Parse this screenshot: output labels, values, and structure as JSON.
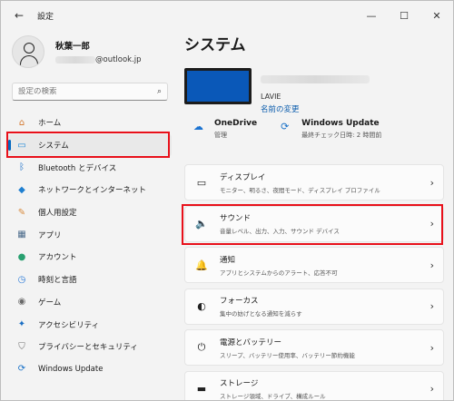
{
  "window": {
    "title": "設定",
    "back": "←",
    "minimize": "—",
    "maximize": "☐",
    "close": "✕"
  },
  "profile": {
    "name": "秋葉一郎",
    "email_domain": "@outlook.jp"
  },
  "search": {
    "placeholder": "設定の検索",
    "icon": "⌕"
  },
  "sidebar": {
    "items": [
      {
        "label": "ホーム",
        "icon": "home-icon",
        "glyph": "⌂",
        "color": "#d4772c"
      },
      {
        "label": "システム",
        "icon": "display-icon",
        "glyph": "▭",
        "color": "#1a86d8"
      },
      {
        "label": "Bluetooth とデバイス",
        "icon": "bluetooth-icon",
        "glyph": "ᛒ",
        "color": "#1a6fc8"
      },
      {
        "label": "ネットワークとインターネット",
        "icon": "wifi-icon",
        "glyph": "◆",
        "color": "#1f7fd0"
      },
      {
        "label": "個人用設定",
        "icon": "brush-icon",
        "glyph": "✎",
        "color": "#d88a3c"
      },
      {
        "label": "アプリ",
        "icon": "apps-icon",
        "glyph": "▦",
        "color": "#4a6a8a"
      },
      {
        "label": "アカウント",
        "icon": "account-icon",
        "glyph": "●",
        "color": "#28a070"
      },
      {
        "label": "時刻と言語",
        "icon": "time-language-icon",
        "glyph": "◷",
        "color": "#2a7ad8"
      },
      {
        "label": "ゲーム",
        "icon": "gamepad-icon",
        "glyph": "◉",
        "color": "#6a6a6a"
      },
      {
        "label": "アクセシビリティ",
        "icon": "accessibility-icon",
        "glyph": "✦",
        "color": "#1b6fc4"
      },
      {
        "label": "プライバシーとセキュリティ",
        "icon": "shield-icon",
        "glyph": "⛉",
        "color": "#6d6d6d"
      },
      {
        "label": "Windows Update",
        "icon": "update-icon",
        "glyph": "⟳",
        "color": "#1a72c8"
      }
    ]
  },
  "main": {
    "title": "システム",
    "device": {
      "model": "LAVIE",
      "rename": "名前の変更"
    },
    "status": [
      {
        "title": "OneDrive",
        "sub": "管理",
        "icon": "onedrive-icon",
        "glyph": "☁",
        "color": "#1b73d1"
      },
      {
        "title": "Windows Update",
        "sub": "最終チェック日時: 2 時間前",
        "icon": "update-icon",
        "glyph": "⟳",
        "color": "#1a72c8"
      }
    ],
    "cards": [
      {
        "title": "ディスプレイ",
        "sub": "モニター、明るさ、夜間モード、ディスプレイ プロファイル",
        "icon": "monitor-icon",
        "glyph": "▭"
      },
      {
        "title": "サウンド",
        "sub": "音量レベル、出力、入力、サウンド デバイス",
        "icon": "speaker-icon",
        "glyph": "🔈"
      },
      {
        "title": "通知",
        "sub": "アプリとシステムからのアラート、応答不可",
        "icon": "bell-icon",
        "glyph": "🔔"
      },
      {
        "title": "フォーカス",
        "sub": "集中の妨げとなる通知を減らす",
        "icon": "focus-icon",
        "glyph": "◐"
      },
      {
        "title": "電源とバッテリー",
        "sub": "スリープ、バッテリー使用率、バッテリー節約機能",
        "icon": "power-icon",
        "glyph": "⏻"
      },
      {
        "title": "ストレージ",
        "sub": "ストレージ領域、ドライブ、構成ルール",
        "icon": "storage-icon",
        "glyph": "▬"
      }
    ],
    "chevron": "›"
  }
}
